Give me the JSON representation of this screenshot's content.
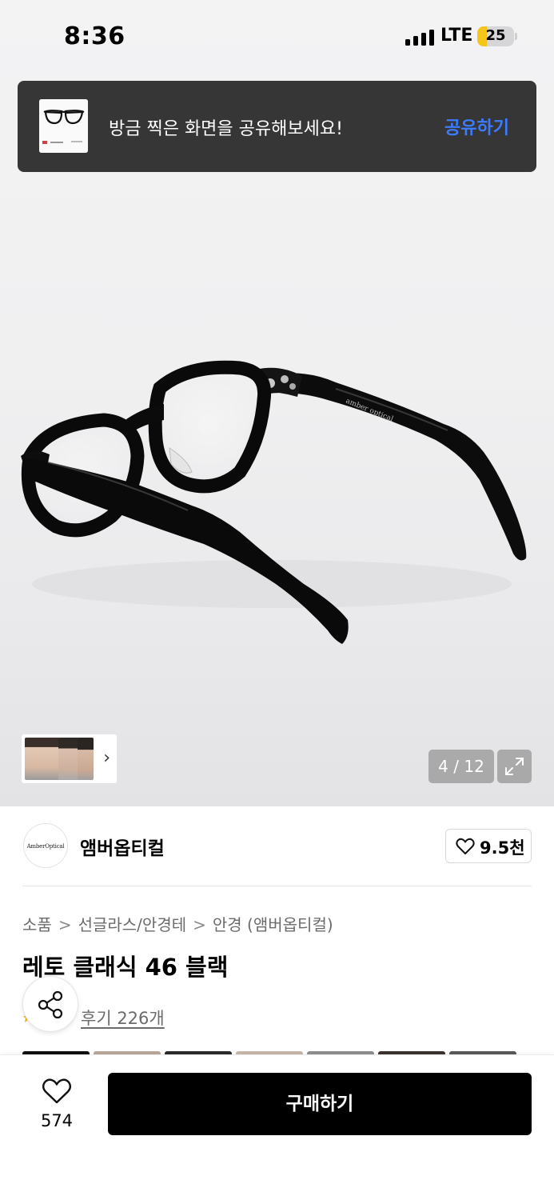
{
  "status_bar": {
    "time": "8:36",
    "network": "LTE",
    "battery": "25",
    "battery_level": 0.25,
    "battery_color": "#f5c518"
  },
  "share_banner": {
    "text": "방금 찍은 화면을 공유해보세요!",
    "action_label": "공유하기",
    "action_color": "#3b7cff"
  },
  "gallery": {
    "current": "4",
    "total": "12",
    "counter_text": "4 / 12",
    "photo_engraving": "amber optical",
    "expand_icon": "expand-icon",
    "thumb_chevron": "›"
  },
  "brand": {
    "logo_text": "AmberOptical",
    "name": "앰버옵티컬",
    "like_count": "9.5천"
  },
  "breadcrumb": [
    "소품",
    "선글라스/안경테",
    "안경 (앰버옵티컬)"
  ],
  "breadcrumb_separator": ">",
  "product": {
    "title": "레토 클래식 46 블랙",
    "review_text": "후기 226개"
  },
  "bottom_bar": {
    "wish_count": "574",
    "buy_label": "구매하기",
    "buy_color": "#000000"
  },
  "icons": {
    "share": "share-icon",
    "heart": "heart-icon",
    "signal": "signal-icon"
  }
}
